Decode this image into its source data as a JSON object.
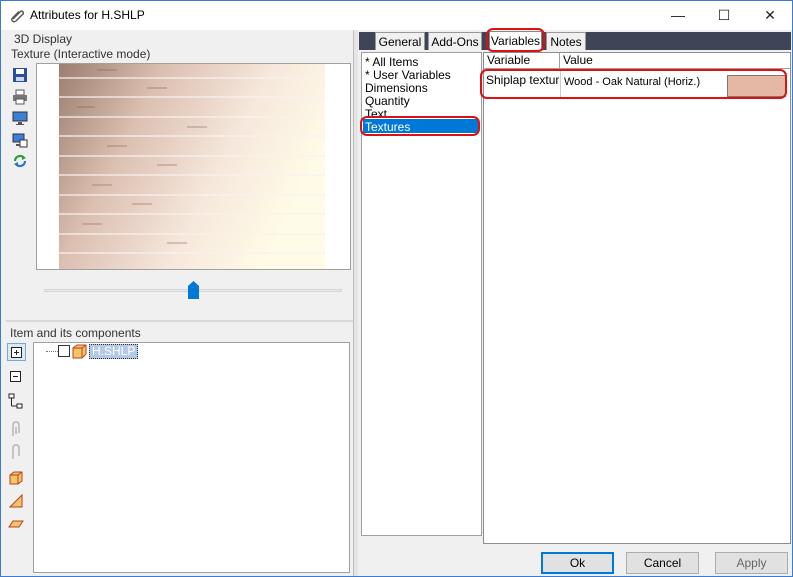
{
  "window": {
    "title": "Attributes for H.SHLP",
    "title_icon": "paperclip-icon",
    "controls": {
      "minimize": "—",
      "maximize": "☐",
      "close": "✕"
    }
  },
  "left": {
    "group_label": "3D Display",
    "preview_label": "Texture (Interactive mode)",
    "toolbar_icons": [
      "save-icon",
      "print-icon",
      "monitor-icon",
      "monitor-export-icon",
      "refresh-icon"
    ],
    "slider_level": 0.5,
    "components_label": "Item and its components",
    "tree_toolbar_icons": [
      "expand-icon",
      "collapse-icon",
      "tree-icon",
      "component-icon",
      "component-disabled-icon",
      "box-icon",
      "wedge-icon",
      "plane-icon"
    ],
    "tree_item": "H.SHLP"
  },
  "tabs": [
    "General",
    "Add-Ons",
    "Variables",
    "Notes"
  ],
  "active_tab": "Variables",
  "categories": [
    "* All Items",
    "* User Variables",
    "Dimensions",
    "Quantity",
    "Text",
    "Textures"
  ],
  "selected_category": "Textures",
  "grid": {
    "headers": [
      "Variable",
      "Value"
    ],
    "rows": [
      {
        "variable": "Shiplap textur",
        "value": "Wood - Oak Natural (Horiz.)",
        "swatch": "#e4b8a4"
      }
    ]
  },
  "buttons": {
    "ok": "Ok",
    "cancel": "Cancel",
    "apply": "Apply"
  },
  "colors": {
    "highlight": "#0078d7",
    "callout": "#dd1111",
    "swatch": "#e4b8a4"
  }
}
